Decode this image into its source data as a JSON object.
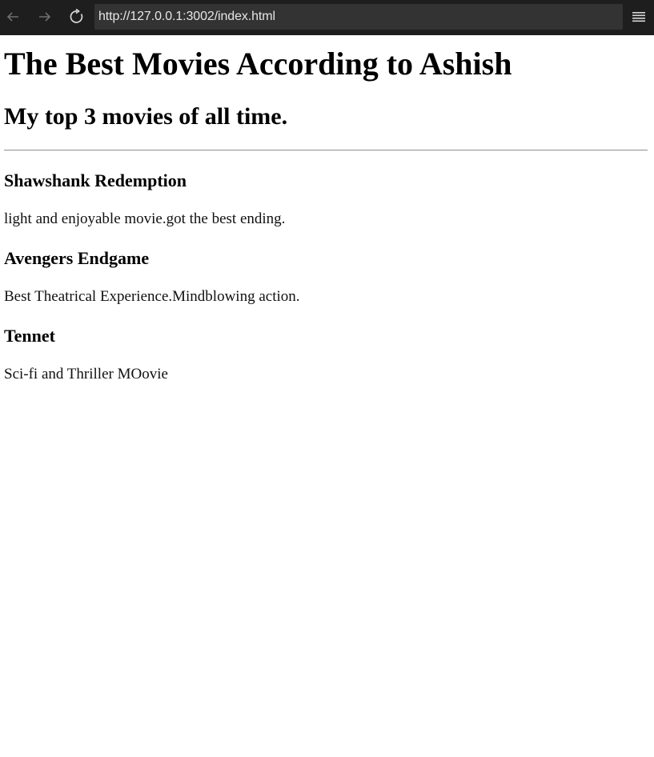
{
  "browser": {
    "url": "http://127.0.0.1:3002/index.html",
    "icons": [
      "back-arrow-icon",
      "forward-arrow-icon",
      "reload-icon",
      "menu-icon"
    ]
  },
  "page": {
    "title": "The Best Movies According to Ashish",
    "subtitle": "My top 3 movies of all time.",
    "movies": [
      {
        "name": "Shawshank Redemption",
        "description": "light and enjoyable movie.got the best ending."
      },
      {
        "name": "Avengers Endgame",
        "description": "Best Theatrical Experience.Mindblowing action."
      },
      {
        "name": "Tennet",
        "description": "Sci-fi and Thriller MOovie"
      }
    ]
  },
  "colors": {
    "toolbar_bg": "#1e1e1e",
    "url_bar_bg": "#333333",
    "url_text": "#e6e6e6"
  }
}
